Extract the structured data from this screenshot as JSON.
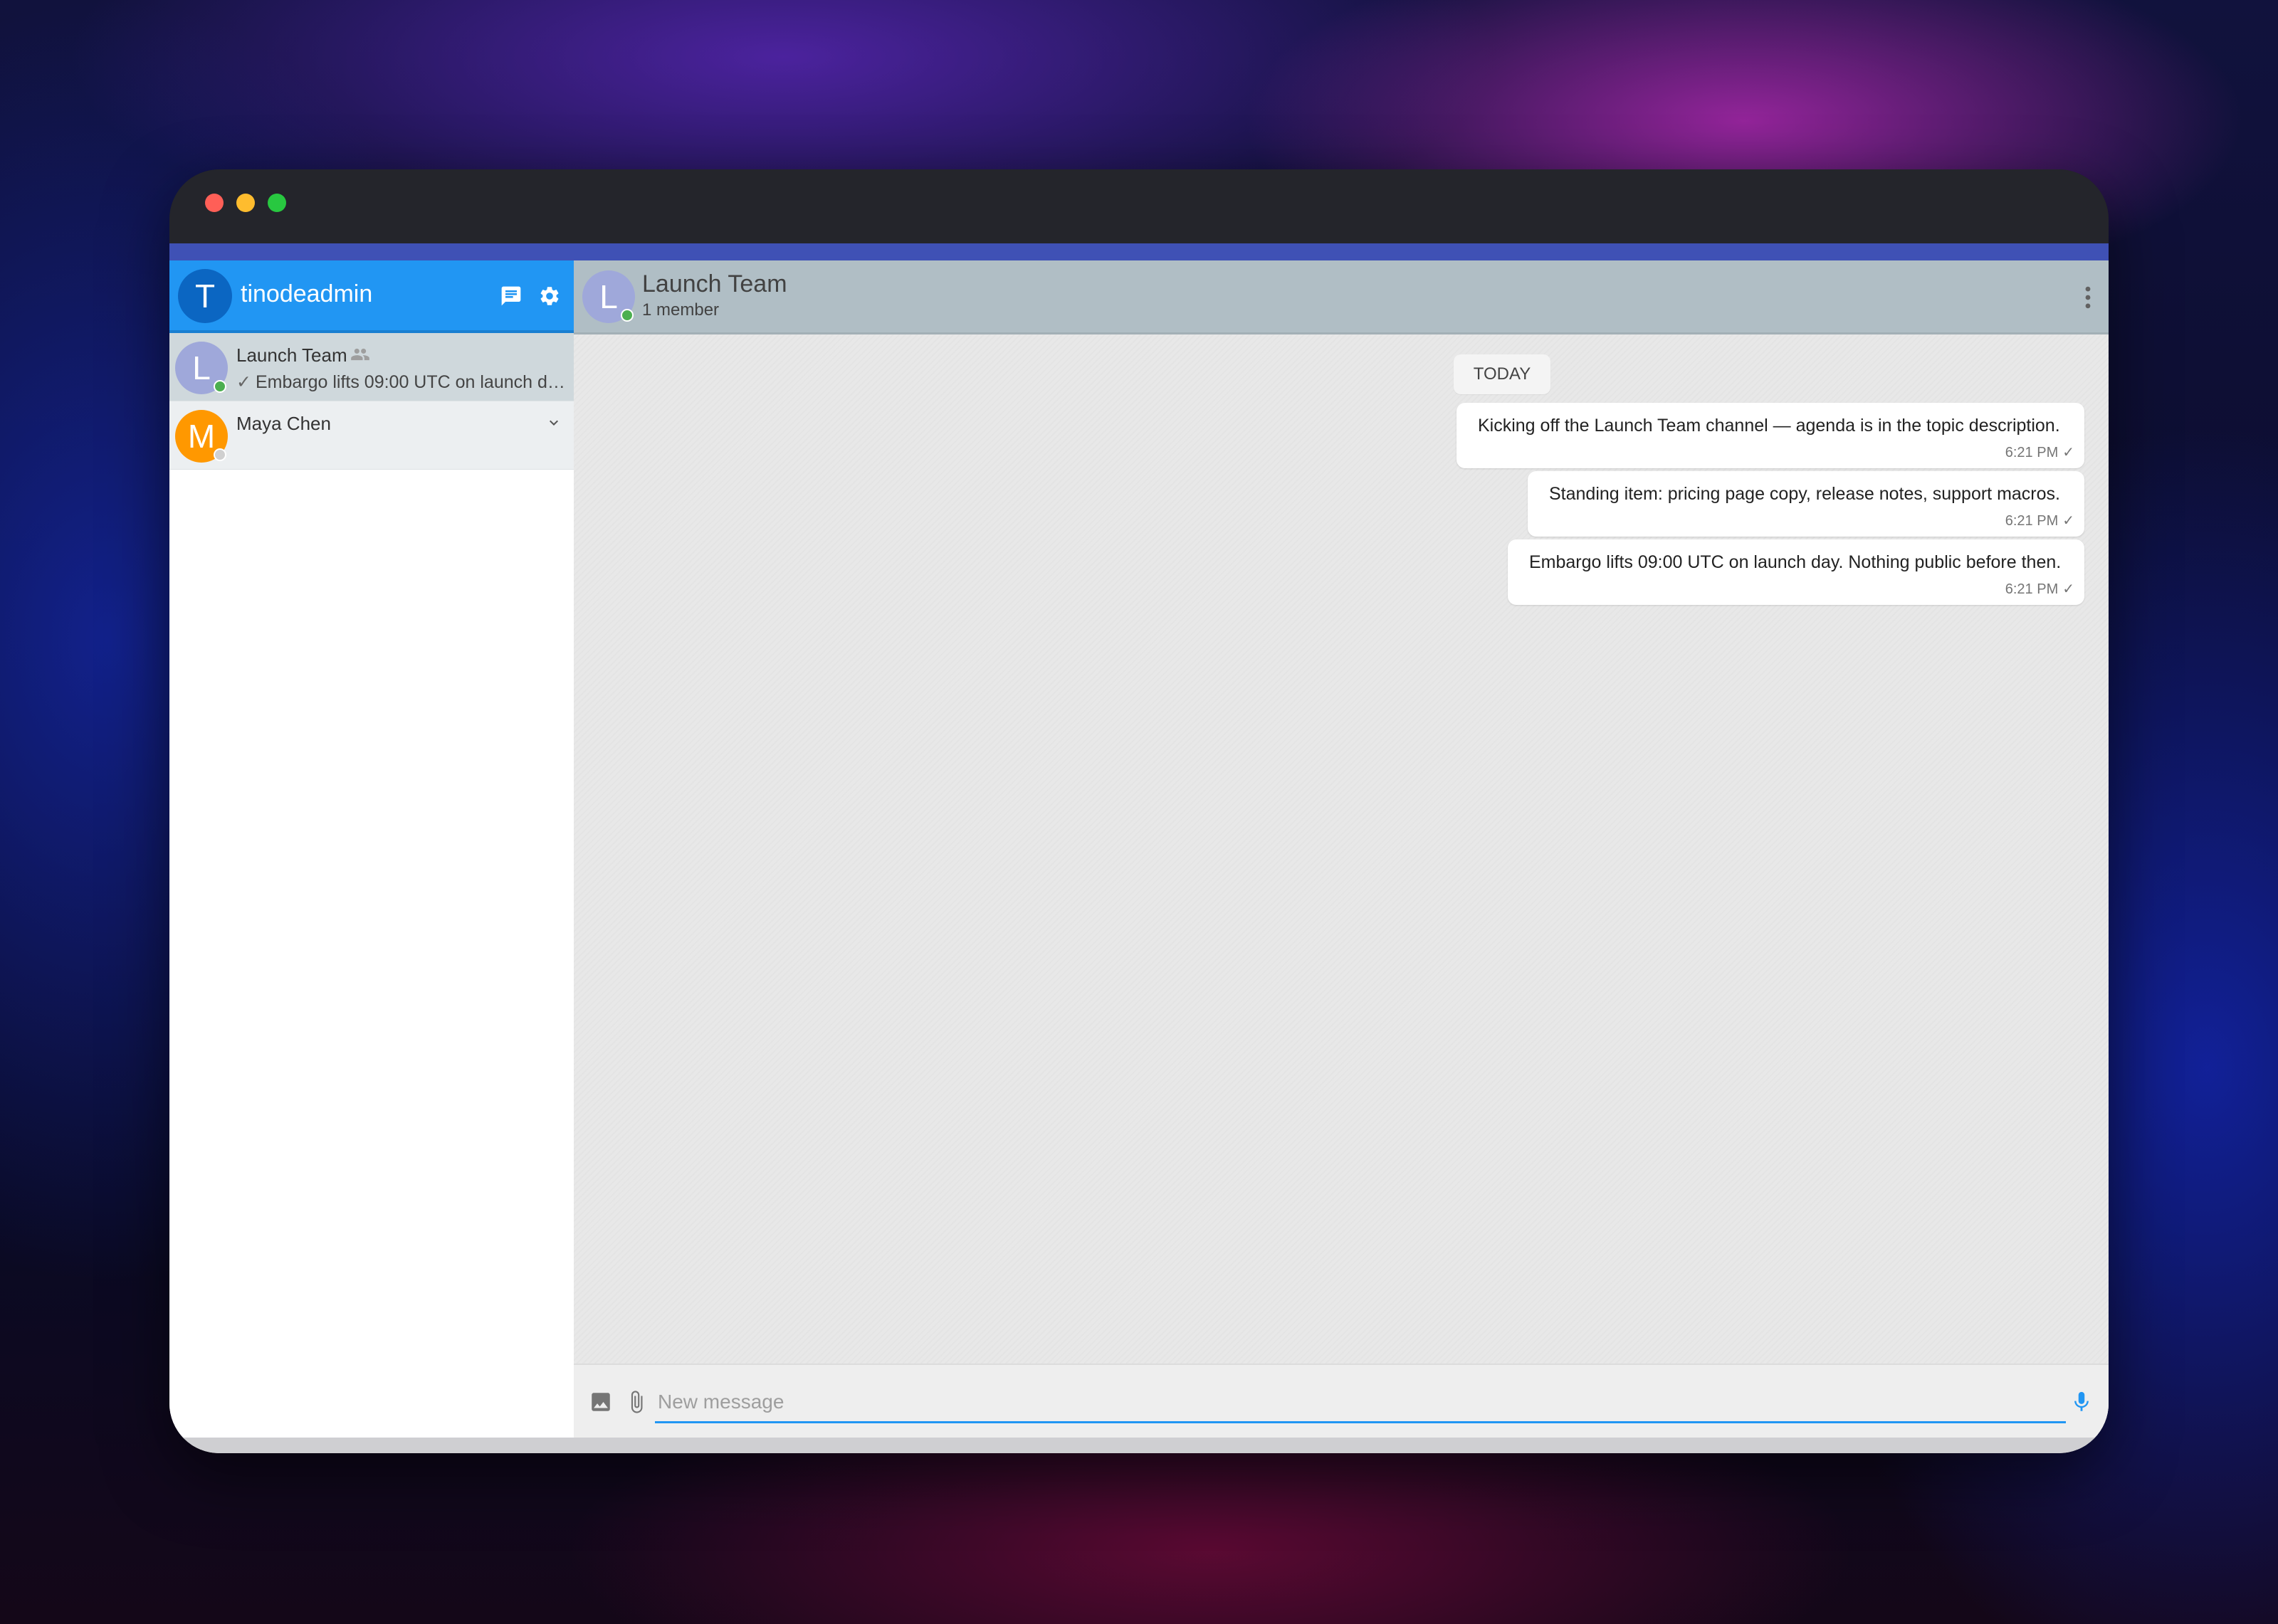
{
  "window": {
    "controls": [
      "close",
      "minimize",
      "maximize"
    ]
  },
  "sidebar": {
    "user": {
      "avatar_letter": "T",
      "name": "tinodeadmin"
    },
    "icons": [
      "chat-icon",
      "gear-icon"
    ],
    "contacts": [
      {
        "avatar_letter": "L",
        "name": "Launch Team",
        "is_group": true,
        "preview": "Embargo lifts 09:00 UTC on launch da...",
        "online": true,
        "selected": true
      },
      {
        "avatar_letter": "M",
        "name": "Maya Chen",
        "preview": "",
        "online": false,
        "selected": false
      }
    ]
  },
  "chat": {
    "avatar_letter": "L",
    "title": "Launch Team",
    "subtitle": "1 member",
    "date_divider": "TODAY",
    "messages": [
      {
        "text": "Kicking off the Launch Team channel — agenda is in the topic description.",
        "time": "6:21 PM",
        "status": "sent"
      },
      {
        "text": "Standing item: pricing page copy, release notes, support macros.",
        "time": "6:21 PM",
        "status": "sent"
      },
      {
        "text": "Embargo lifts 09:00 UTC on launch day. Nothing public before then.",
        "time": "6:21 PM",
        "status": "sent"
      }
    ],
    "composer": {
      "placeholder": "New message",
      "value": ""
    }
  },
  "colors": {
    "sidebar_header": "#2196f3",
    "chat_header": "#b0bec5",
    "accent_bar": "#3f51b5",
    "online": "#4caf50",
    "avatar_launch_team": "#9fa8da",
    "avatar_maya": "#ff9800"
  }
}
